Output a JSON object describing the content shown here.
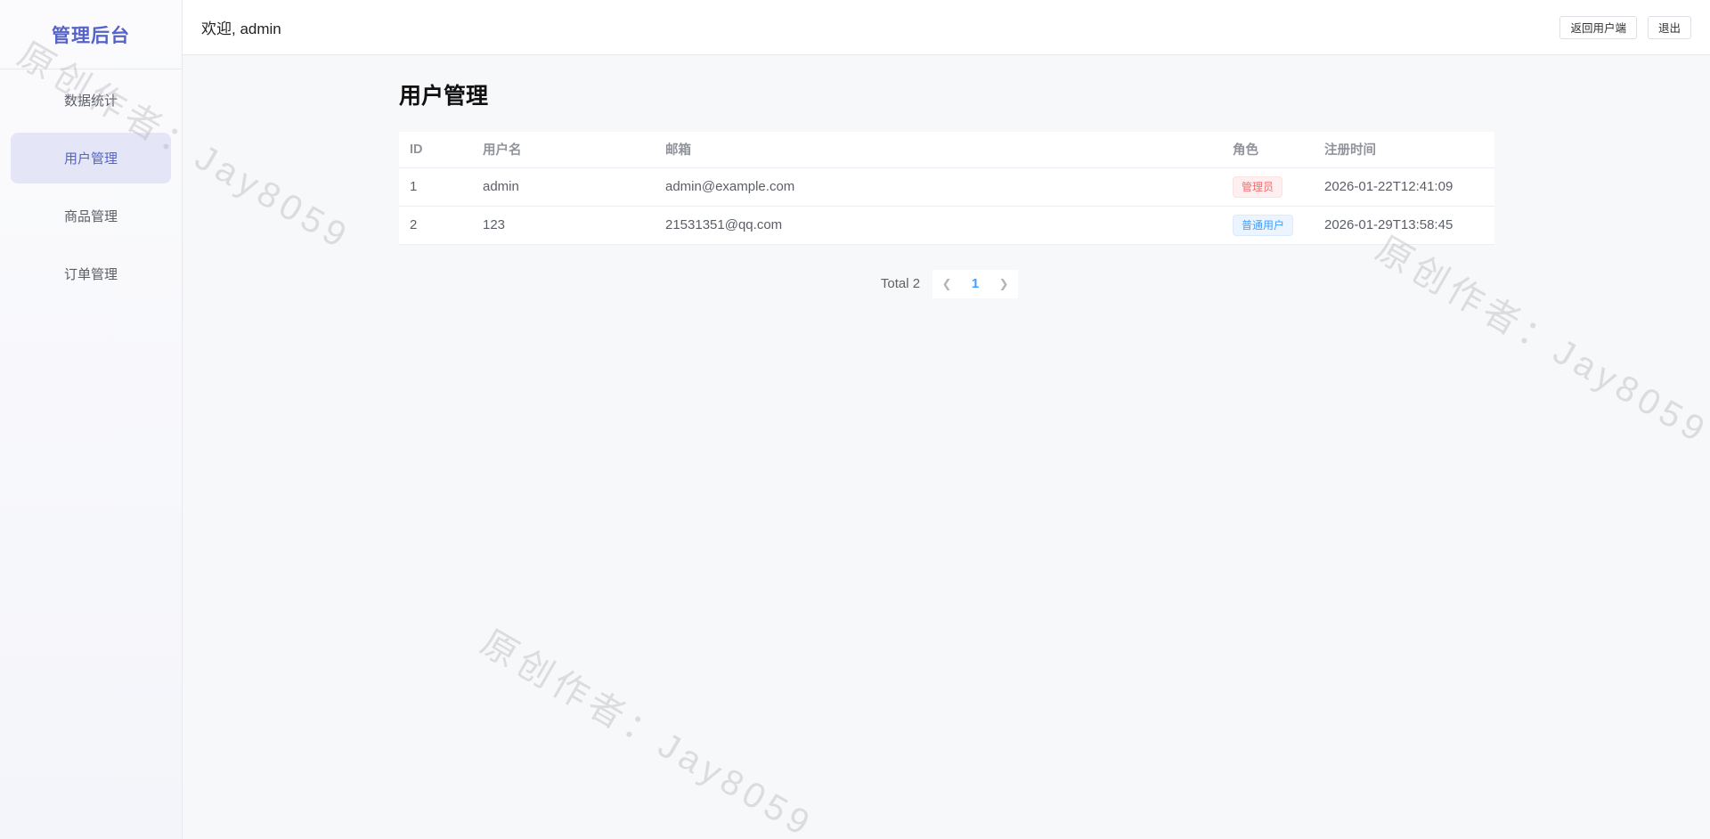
{
  "sidebar": {
    "brand": "管理后台",
    "items": [
      {
        "label": "数据统计"
      },
      {
        "label": "用户管理"
      },
      {
        "label": "商品管理"
      },
      {
        "label": "订单管理"
      }
    ]
  },
  "header": {
    "welcome": "欢迎, admin",
    "back_label": "返回用户端",
    "logout_label": "退出"
  },
  "main": {
    "title": "用户管理",
    "columns": [
      "ID",
      "用户名",
      "邮箱",
      "角色",
      "注册时间"
    ],
    "rows": [
      {
        "id": "1",
        "username": "admin",
        "email": "admin@example.com",
        "role": "管理员",
        "registered": "2026-01-22T12:41:09"
      },
      {
        "id": "2",
        "username": "123",
        "email": "21531351@qq.com",
        "role": "普通用户",
        "registered": "2026-01-29T13:58:45"
      }
    ],
    "pagination": {
      "total": "Total 2",
      "page": "1"
    }
  },
  "watermark": "原创作者：Jay8059",
  "colors": {
    "accent": "#5563c7",
    "active_bg": "#e4e6f7",
    "admin_tag": "#f56c6c",
    "user_tag": "#409eff"
  }
}
